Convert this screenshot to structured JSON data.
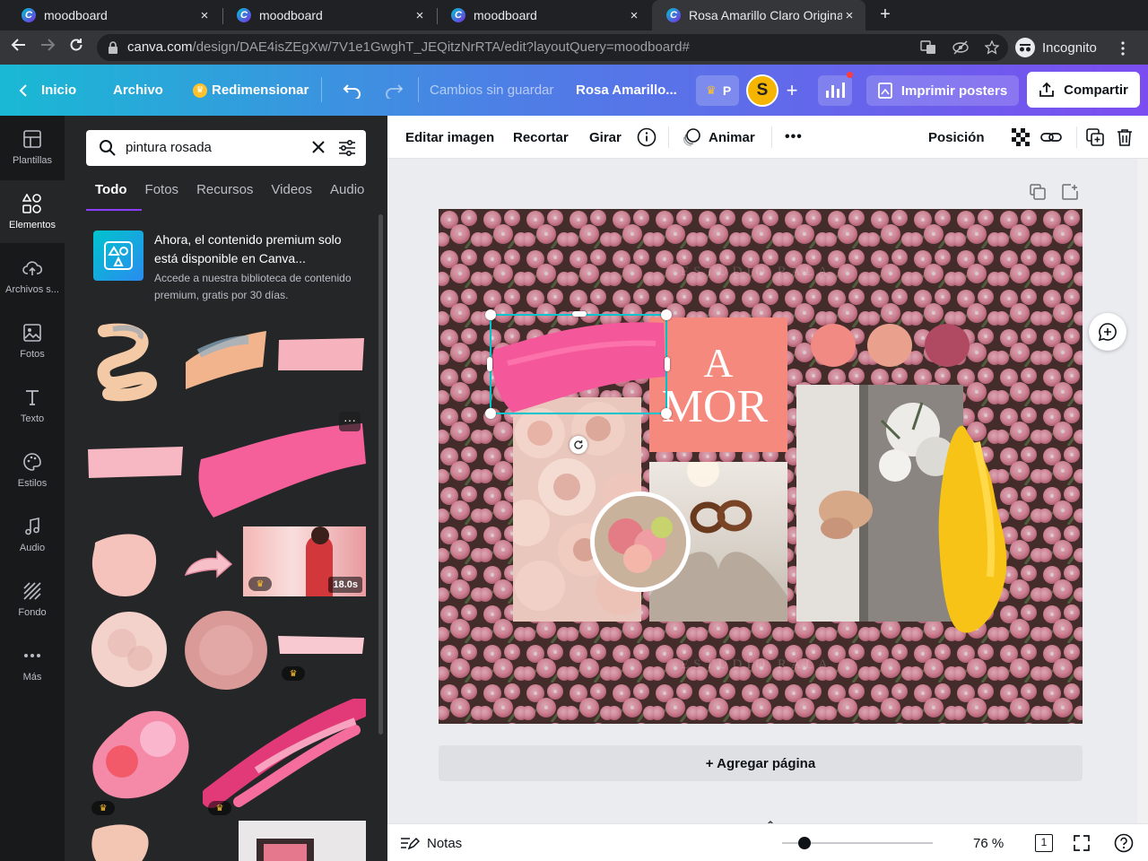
{
  "browser": {
    "tabs": [
      {
        "title": "moodboard",
        "close": "×"
      },
      {
        "title": "moodboard",
        "close": "×"
      },
      {
        "title": "moodboard",
        "close": "×"
      },
      {
        "title": "Rosa Amarillo Claro Original",
        "close": "×"
      }
    ],
    "new_tab": "+",
    "url_host": "canva.com",
    "url_path": "/design/DAE4isZEgXw/7V1e1GwghT_JEQitzNrRTA/edit?layoutQuery=moodboard#",
    "incognito_label": "Incognito"
  },
  "header": {
    "home": "Inicio",
    "file": "Archivo",
    "resize": "Redimensionar",
    "status": "Cambios sin guardar",
    "title": "Rosa Amarillo...",
    "pro_letter": "P",
    "avatar_letter": "S",
    "print": "Imprimir posters",
    "share": "Compartir"
  },
  "rail": {
    "items": [
      {
        "label": "Plantillas",
        "icon": "template-icon"
      },
      {
        "label": "Elementos",
        "icon": "elements-icon"
      },
      {
        "label": "Archivos s...",
        "icon": "upload-icon"
      },
      {
        "label": "Fotos",
        "icon": "photo-icon"
      },
      {
        "label": "Texto",
        "icon": "text-icon"
      },
      {
        "label": "Estilos",
        "icon": "palette-icon"
      },
      {
        "label": "Audio",
        "icon": "music-icon"
      },
      {
        "label": "Fondo",
        "icon": "background-icon"
      },
      {
        "label": "Más",
        "icon": "more-icon"
      }
    ]
  },
  "panel": {
    "search_value": "pintura rosada",
    "tabs": [
      "Todo",
      "Fotos",
      "Recursos",
      "Videos",
      "Audio"
    ],
    "promo_title": "Ahora, el contenido premium solo está disponible en Canva...",
    "promo_sub": "Accede a nuestra biblioteca de contenido premium, gratis por 30 días.",
    "video_duration": "18.0s",
    "more": "···"
  },
  "toolbar": {
    "edit_image": "Editar imagen",
    "crop": "Recortar",
    "rotate": "Girar",
    "animate": "Animar",
    "more": "•••",
    "position": "Posición"
  },
  "design": {
    "word_a": "A",
    "word_mor": "MOR",
    "faint_top": "ESTUDIO RALA",
    "faint_bottom": "ESTUDIO RALA",
    "colors": {
      "swatch1": "#f08a82",
      "swatch2": "#e9a08c",
      "swatch3": "#b04a62",
      "amor_bg": "#f5897e",
      "selection": "#00c4cc"
    }
  },
  "workspace": {
    "add_page": "+ Agregar página"
  },
  "bottombar": {
    "notes": "Notas",
    "zoom": "76 %",
    "page_count": "1"
  }
}
